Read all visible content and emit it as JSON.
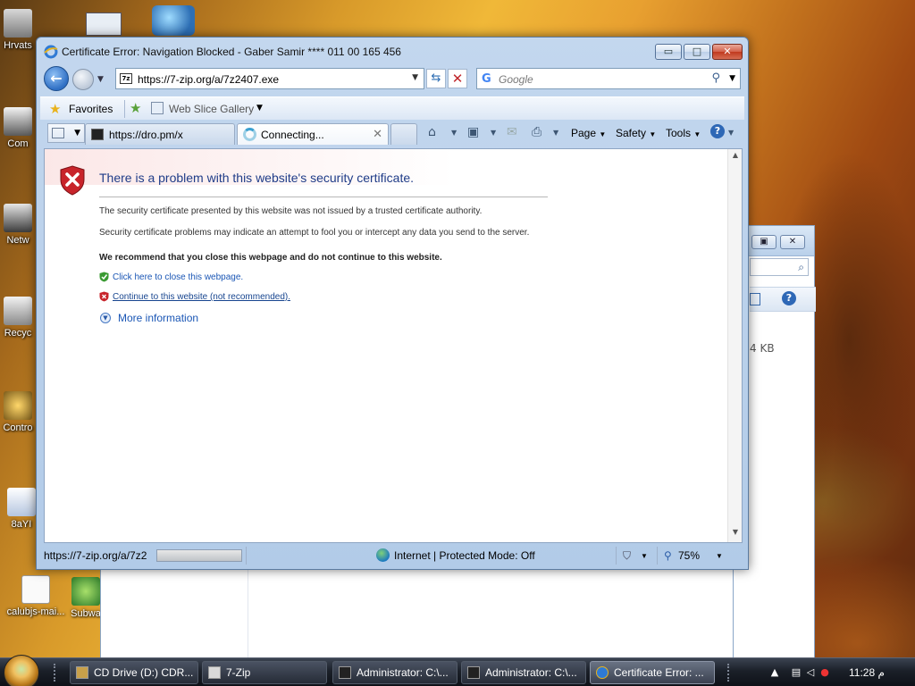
{
  "desktop": {
    "icons": [
      {
        "label": "Hrvats"
      },
      {
        "label": "Com"
      },
      {
        "label": "Netw"
      },
      {
        "label": "Recyc"
      },
      {
        "label": "Contro"
      },
      {
        "label": "8aYI"
      },
      {
        "label": "calubjs-mai..."
      },
      {
        "label": "Subwa"
      }
    ]
  },
  "back_window": {
    "size_text": "4 KB",
    "restore_label": "▣",
    "close_label": "✕",
    "help_label": "?"
  },
  "ie": {
    "title": "Certificate Error: Navigation Blocked - Gaber Samir **** 011 00 165 456",
    "caption": {
      "min": "▭",
      "max": "□",
      "close": "✕"
    },
    "address": {
      "url": "https://7-zip.org/a/7z2407.exe",
      "favicon": "7z"
    },
    "search": {
      "placeholder": "Google",
      "engine_glyph": "G"
    },
    "favorites_bar": {
      "favorites_label": "Favorites",
      "web_slice_label": "Web Slice Gallery"
    },
    "tabs": [
      {
        "label": "https://dro.pm/x",
        "active": false
      },
      {
        "label": "Connecting...",
        "active": true
      }
    ],
    "command_bar": {
      "page": "Page",
      "safety": "Safety",
      "tools": "Tools"
    },
    "page": {
      "heading": "There is a problem with this website's security certificate.",
      "para1": "The security certificate presented by this website was not issued by a trusted certificate authority.",
      "para2": "Security certificate problems may indicate an attempt to fool you or intercept any data you send to the server.",
      "recommend": "We recommend that you close this webpage and do not continue to this website.",
      "close_link": "Click here to close this webpage.",
      "continue_link": "Continue to this website (not recommended).",
      "more_info": "More information"
    },
    "status": {
      "url_text": "https://7-zip.org/a/7z2",
      "zone": "Internet | Protected Mode: Off",
      "zoom": "75%"
    }
  },
  "taskbar": {
    "buttons": [
      {
        "label": "CD Drive (D:) CDR..."
      },
      {
        "label": "7-Zip"
      },
      {
        "label": "Administrator: C:\\..."
      },
      {
        "label": "Administrator: C:\\..."
      },
      {
        "label": "Certificate Error: ..."
      }
    ],
    "clock": "11:28 م"
  }
}
